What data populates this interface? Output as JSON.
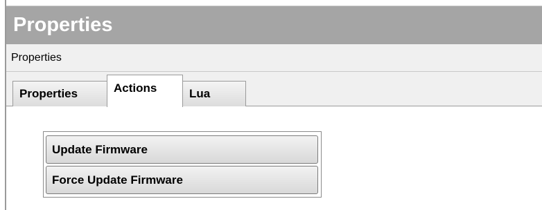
{
  "panel": {
    "title": "Properties",
    "subtitle": "Properties"
  },
  "tabs": [
    {
      "label": "Properties",
      "active": false
    },
    {
      "label": "Actions",
      "active": true
    },
    {
      "label": "Lua",
      "active": false
    }
  ],
  "actions": {
    "update_firmware_label": "Update Firmware",
    "force_update_firmware_label": "Force Update Firmware"
  },
  "colors": {
    "title_bar": "#a5a5a5",
    "title_text": "#ffffff",
    "subheader_bg": "#f0f0f0"
  }
}
